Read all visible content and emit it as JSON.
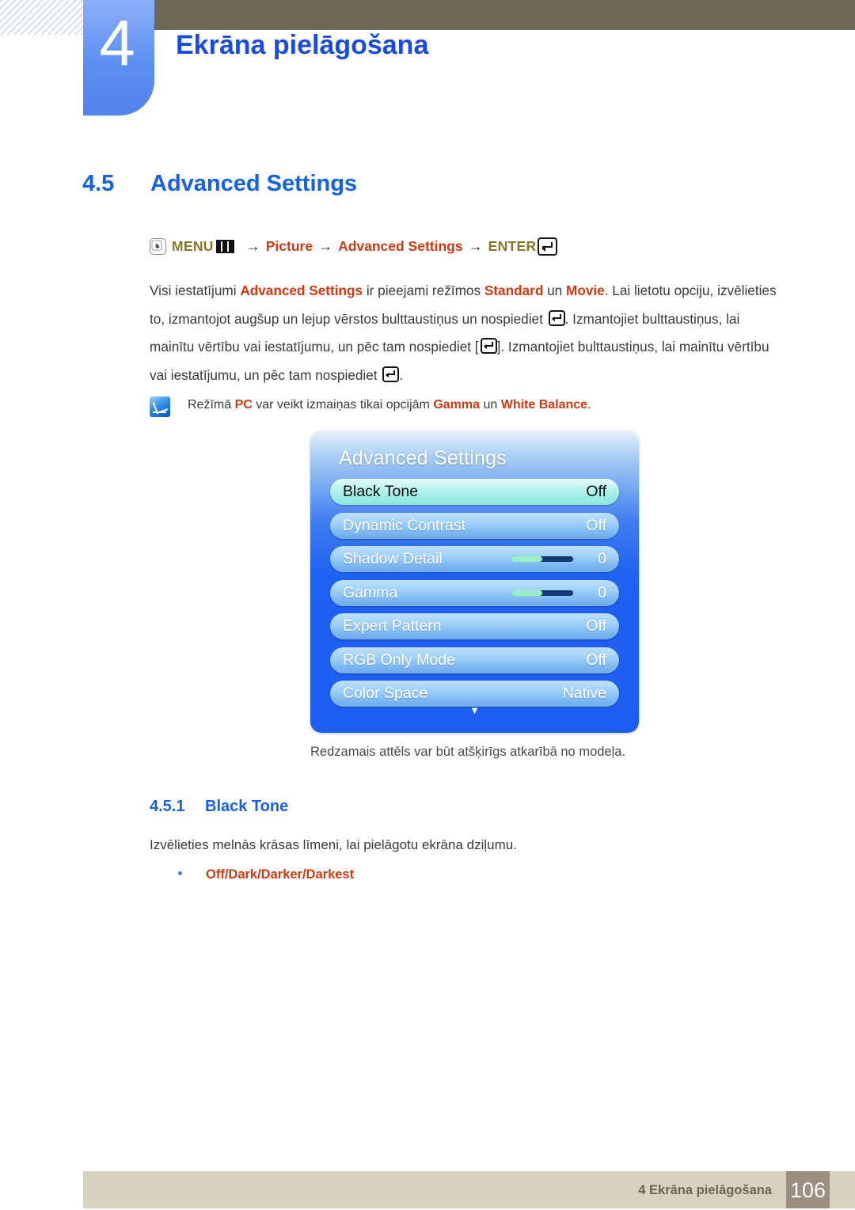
{
  "header": {
    "chapter_number": "4",
    "chapter_title": "Ekrāna pielāgošana"
  },
  "section": {
    "number": "4.5",
    "title": "Advanced Settings"
  },
  "breadcrumb": {
    "hand_icon": "hand-press-icon",
    "menu_label": "MENU",
    "menu_icon": "menu-bars-icon",
    "arrow": "→",
    "item1": "Picture",
    "item2": "Advanced Settings",
    "enter_label": "ENTER",
    "enter_icon": "enter-key-icon"
  },
  "body": {
    "p1_a": "Visi iestatījumi ",
    "p1_em1": "Advanced Settings",
    "p1_b": " ir pieejami režīmos ",
    "p1_em2": "Standard",
    "p1_c": " un ",
    "p1_em3": "Movie",
    "p1_d": ". Lai lietotu opciju, izvēlieties to, izmantojot augšup un lejup vērstos bulttaustiņus un nospiediet ",
    "p1_e": ". Izmantojiet bulttaustiņus, lai mainītu vērtību vai iestatījumu, un pēc tam nospiediet [",
    "p1_f": "]. Izmantojiet bulttaustiņus, lai mainītu vērtību vai iestatījumu, un pēc tam nospiediet ",
    "p1_g": "."
  },
  "note": {
    "icon": "pen-note-icon",
    "a": "Režīmā ",
    "em1": "PC",
    "b": " var veikt izmaiņas tikai opcijām ",
    "em2": "Gamma",
    "c": " un ",
    "em3": "White Balance",
    "d": "."
  },
  "osd": {
    "title": "Advanced Settings",
    "caret": "▼",
    "caption": "Redzamais attēls var būt atšķirīgs atkarībā no modeļa.",
    "rows": [
      {
        "label": "Black Tone",
        "value": "Off",
        "type": "value",
        "selected": true
      },
      {
        "label": "Dynamic Contrast",
        "value": "Off",
        "type": "value",
        "selected": false
      },
      {
        "label": "Shadow Detail",
        "value": "0",
        "type": "slider",
        "fill": 50,
        "selected": false
      },
      {
        "label": "Gamma",
        "value": "0",
        "type": "slider",
        "fill": 50,
        "selected": false
      },
      {
        "label": "Expert Pattern",
        "value": "Off",
        "type": "value",
        "selected": false
      },
      {
        "label": "RGB Only Mode",
        "value": "Off",
        "type": "value",
        "selected": false
      },
      {
        "label": "Color Space",
        "value": "Native",
        "type": "value",
        "selected": false
      }
    ]
  },
  "subsection": {
    "number": "4.5.1",
    "title": "Black Tone",
    "description": "Izvēlieties melnās krāsas līmeni, lai pielāgotu ekrāna dziļumu.",
    "options": "Off/Dark/Darker/Darkest"
  },
  "footer": {
    "text": "4 Ekrāna pielāgošana",
    "page": "106"
  },
  "colors": {
    "accent_blue": "#1560e8",
    "accent_red": "#cc3b12",
    "olive": "#6c6a57",
    "tab_blue": "#5c8ff0",
    "footer_bg": "#d8d3c0",
    "page_badge": "#9c8f80",
    "osd_blue": "#1f61f2"
  }
}
